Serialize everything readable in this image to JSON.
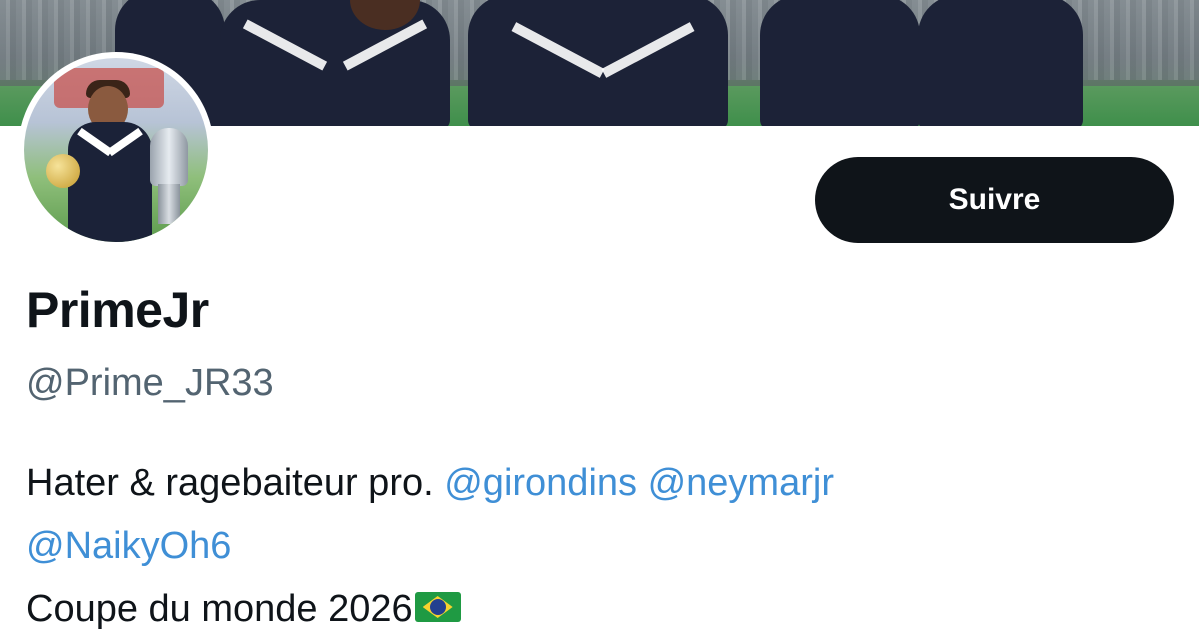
{
  "profile": {
    "display_name": "PrimeJr",
    "handle": "@Prime_JR33",
    "follow_label": "Suivre",
    "bio": {
      "line1_text": "Hater & ragebaiteur pro.",
      "mentions_line1": [
        "@girondins",
        "@neymarjr"
      ],
      "mention_line2": "@NaikyOh6",
      "line3_text": "Coupe du monde 2026",
      "line3_emoji": "brazil-flag-icon"
    }
  },
  "colors": {
    "mention": "#3f8fd6",
    "button_bg": "#0f1419",
    "handle": "#536471"
  }
}
